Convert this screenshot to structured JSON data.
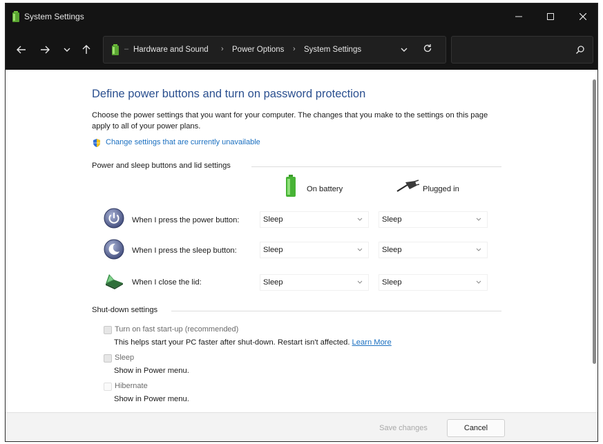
{
  "window": {
    "title": "System Settings"
  },
  "nav": {
    "breadcrumbs": [
      "Hardware and Sound",
      "Power Options",
      "System Settings"
    ],
    "search_placeholder": ""
  },
  "page": {
    "heading": "Define power buttons and turn on password protection",
    "description": "Choose the power settings that you want for your computer. The changes that you make to the settings on this page apply to all of your power plans.",
    "change_link": "Change settings that are currently unavailable"
  },
  "power_section": {
    "title": "Power and sleep buttons and lid settings",
    "columns": [
      "On battery",
      "Plugged in"
    ],
    "rows": [
      {
        "label": "When I press the power button:",
        "on_battery": "Sleep",
        "plugged_in": "Sleep"
      },
      {
        "label": "When I press the sleep button:",
        "on_battery": "Sleep",
        "plugged_in": "Sleep"
      },
      {
        "label": "When I close the lid:",
        "on_battery": "Sleep",
        "plugged_in": "Sleep"
      }
    ]
  },
  "shutdown_section": {
    "title": "Shut-down settings",
    "options": [
      {
        "label": "Turn on fast start-up (recommended)",
        "description": "This helps start your PC faster after shut-down. Restart isn't affected.",
        "link": "Learn More",
        "checked": false
      },
      {
        "label": "Sleep",
        "description": "Show in Power menu.",
        "checked": false
      },
      {
        "label": "Hibernate",
        "description": "Show in Power menu.",
        "checked": false
      }
    ]
  },
  "footer": {
    "save_label": "Save changes",
    "cancel_label": "Cancel"
  },
  "colors": {
    "heading": "#2a4f8f",
    "link": "#1a6fc0",
    "titlebar": "#141414"
  }
}
